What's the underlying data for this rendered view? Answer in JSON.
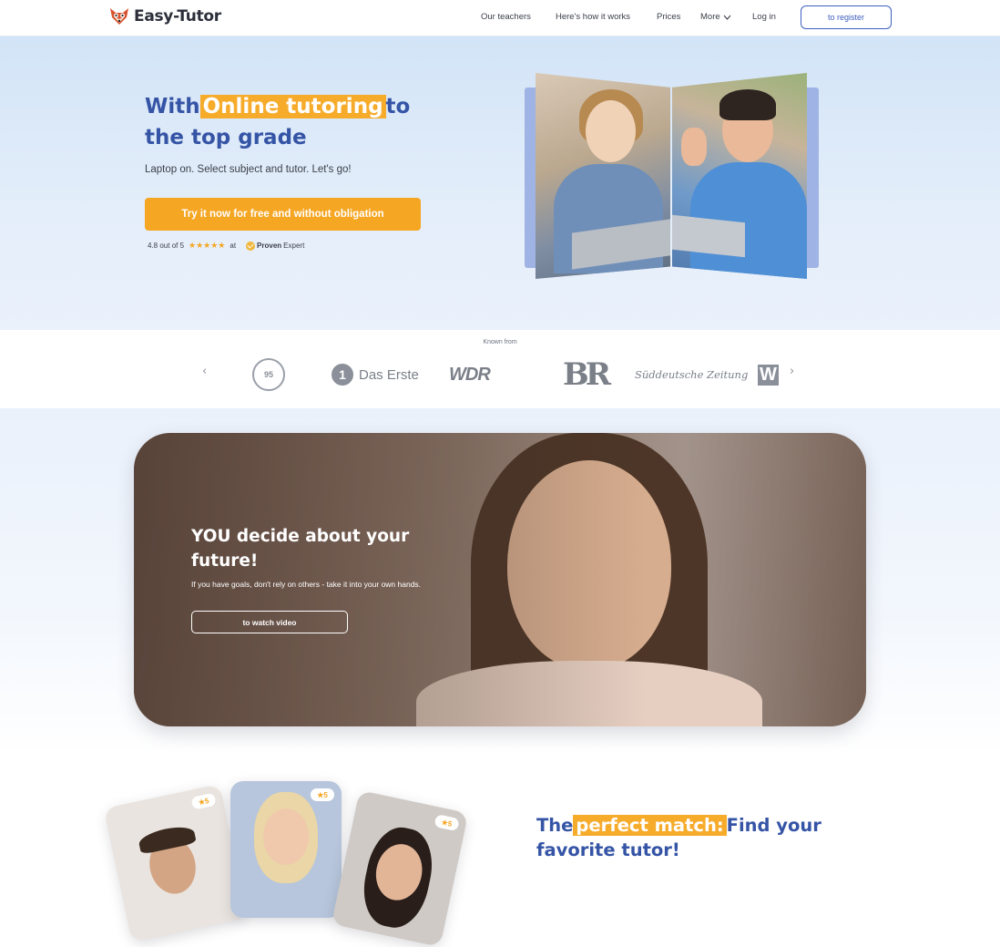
{
  "nav": {
    "brand": "Easy-Tutor",
    "links": [
      "Our teachers",
      "Here's how it works",
      "Prices",
      "More",
      "Log in"
    ],
    "register": "to register"
  },
  "hero": {
    "title_pre": "With",
    "title_highlight": "Online tutoring",
    "title_post": "to the top grade",
    "subtitle": "Laptop on. Select subject and tutor. Let's go!",
    "cta": "Try it now for free and without obligation",
    "rating_text": "4.8 out of 5",
    "stars": "★★★★★",
    "rating_at": "at",
    "proven": "Proven",
    "expert": "Expert"
  },
  "known": {
    "title": "Known from",
    "logos": [
      "95",
      "Das Erste",
      "WDR",
      "BR",
      "Süddeutsche Zeitung",
      "W"
    ]
  },
  "video": {
    "title": "YOU decide about your future!",
    "subtitle": "If you have goals, don't rely on others - take it into your own hands.",
    "button": "to watch video"
  },
  "tutors": {
    "badges": [
      "★5",
      "★5",
      "★5"
    ],
    "title_pre": "The",
    "title_highlight": "perfect match:",
    "title_post": "Find your favorite tutor!"
  },
  "colors": {
    "accent": "#f5a623",
    "primary": "#3554a6"
  }
}
